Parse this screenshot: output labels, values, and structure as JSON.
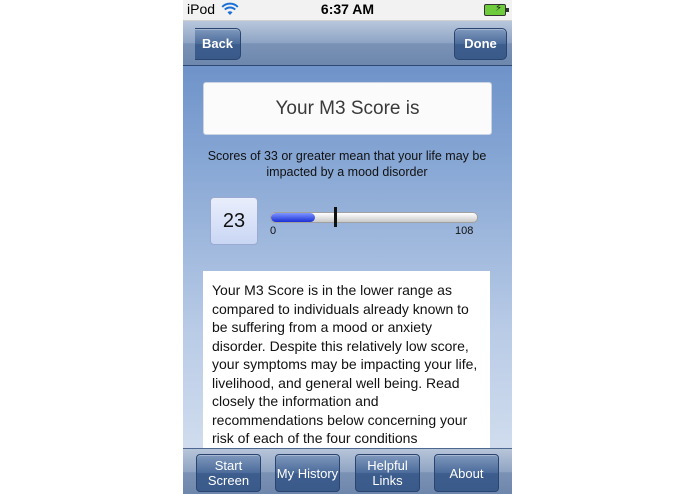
{
  "status_bar": {
    "carrier": "iPod",
    "time": "6:37 AM"
  },
  "navbar": {
    "back_label": "Back",
    "done_label": "Done"
  },
  "score_title": "Your M3 Score is",
  "threshold_note": "Scores of 33 or greater mean that your life may be impacted by a mood disorder",
  "score": {
    "value": "23",
    "min_label": "0",
    "max_label": "108",
    "score_fraction": 0.213,
    "threshold_fraction": 0.306,
    "fill_color": "#1a2fd6"
  },
  "description": "Your M3 Score is in the lower range as compared to individuals already known to be suffering from a mood or anxiety disorder. Despite this relatively low score, your symptoms may be impacting your life, livelihood, and general well being. Read closely the information and recommendations below concerning your risk of each of the four conditions",
  "toolbar": {
    "buttons": [
      {
        "label": "Start\nScreen"
      },
      {
        "label": "My History"
      },
      {
        "label": "Helpful\nLinks"
      },
      {
        "label": "About"
      }
    ]
  },
  "colors": {
    "nav_accent": "#3c5d8d",
    "background_top": "#5f86c2",
    "background_bottom": "#d9e3f1"
  },
  "icons": [
    "wifi-icon",
    "battery-icon",
    "back-chevron-icon"
  ]
}
